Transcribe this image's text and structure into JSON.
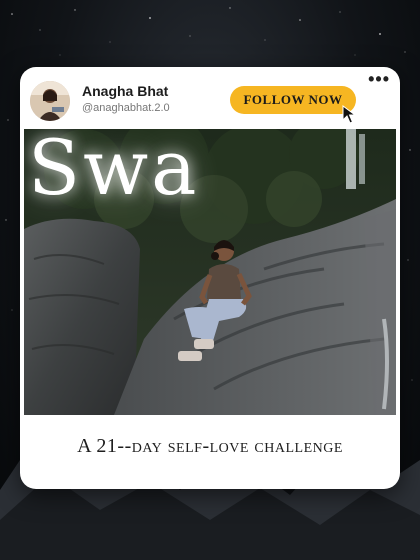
{
  "profile": {
    "name": "Anagha Bhat",
    "handle": "@anaghabhat.2.0"
  },
  "actions": {
    "follow_label": "FOLLOW NOW",
    "more_icon": "more-icon"
  },
  "post": {
    "title": "Swa",
    "caption": "A 21--day self-love challenge"
  },
  "colors": {
    "accent": "#f6b622",
    "card": "#ffffff",
    "background": "#111418"
  }
}
